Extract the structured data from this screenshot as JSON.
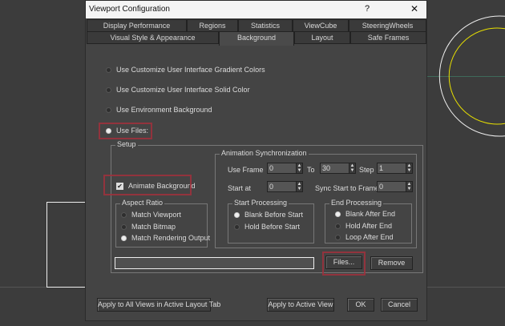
{
  "dialog": {
    "title": "Viewport Configuration",
    "help": "?",
    "close": "✕"
  },
  "tabs_row1": [
    "Display Performance",
    "Regions",
    "Statistics",
    "ViewCube",
    "SteeringWheels"
  ],
  "tabs_row2": [
    "Visual Style & Appearance",
    "Background",
    "Layout",
    "Safe Frames"
  ],
  "active_tab": "Background",
  "source_options": [
    "Use Customize User Interface Gradient Colors",
    "Use Customize User Interface Solid Color",
    "Use Environment Background",
    "Use Files:"
  ],
  "setup": {
    "label": "Setup",
    "animate_background": "Animate Background",
    "animate_checked": true,
    "aspect": {
      "label": "Aspect Ratio",
      "options": [
        "Match Viewport",
        "Match Bitmap",
        "Match Rendering Output"
      ]
    },
    "sync": {
      "label": "Animation Synchronization",
      "use_frame": "Use Frame",
      "use_frame_val": "0",
      "to": "To",
      "to_val": "30",
      "step": "Step",
      "step_val": "1",
      "start_at": "Start at",
      "start_at_val": "0",
      "sync_start": "Sync Start to Frame",
      "sync_start_val": "0"
    },
    "start_proc": {
      "label": "Start Processing",
      "options": [
        "Blank Before Start",
        "Hold Before Start"
      ]
    },
    "end_proc": {
      "label": "End Processing",
      "options": [
        "Blank After End",
        "Hold After End",
        "Loop After End"
      ]
    },
    "file_path": "",
    "files_btn": "Files...",
    "remove_btn": "Remove"
  },
  "buttons": {
    "apply_all": "Apply to All Views in Active Layout Tab",
    "apply_active": "Apply to Active View",
    "ok": "OK",
    "cancel": "Cancel"
  }
}
